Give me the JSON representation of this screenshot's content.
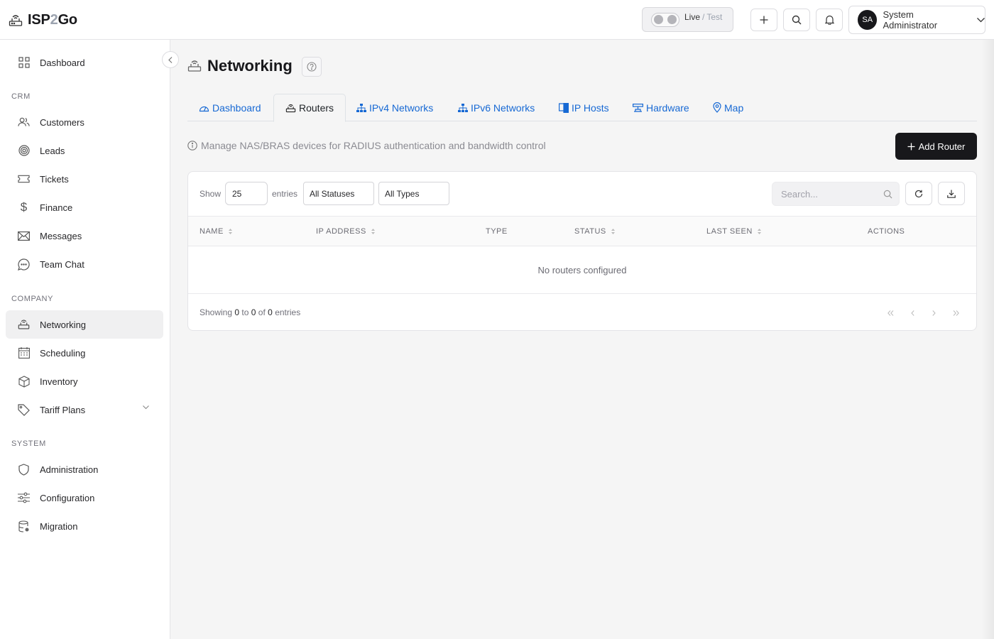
{
  "header": {
    "logo_prefix": "ISP",
    "logo_mid": "2",
    "logo_suffix": "Go",
    "mode_live": "Live",
    "mode_sep": "/",
    "mode_test": "Test",
    "user_initials": "SA",
    "user_name": "System Administrator",
    "icons": [
      "router-icon",
      "plus-icon",
      "search-icon",
      "bell-icon",
      "chevron-down-icon"
    ]
  },
  "sidebar": {
    "top": {
      "label": "Dashboard",
      "icon": "grid-icon"
    },
    "crm_label": "CRM",
    "crm": [
      {
        "label": "Customers",
        "icon": "users-icon"
      },
      {
        "label": "Leads",
        "icon": "target-icon"
      },
      {
        "label": "Tickets",
        "icon": "ticket-icon"
      },
      {
        "label": "Finance",
        "icon": "dollar-icon"
      },
      {
        "label": "Messages",
        "icon": "mail-icon"
      },
      {
        "label": "Team Chat",
        "icon": "chat-icon"
      }
    ],
    "company_label": "COMPANY",
    "company": [
      {
        "label": "Networking",
        "icon": "router-icon",
        "active": true
      },
      {
        "label": "Scheduling",
        "icon": "calendar-icon"
      },
      {
        "label": "Inventory",
        "icon": "box-icon"
      },
      {
        "label": "Tariff Plans",
        "icon": "tag-icon"
      }
    ],
    "system_label": "SYSTEM",
    "system": [
      {
        "label": "Administration",
        "icon": "shield-icon"
      },
      {
        "label": "Configuration",
        "icon": "sliders-icon"
      },
      {
        "label": "Migration",
        "icon": "database-icon"
      }
    ]
  },
  "page": {
    "title": "Networking",
    "tabs": [
      {
        "label": "Dashboard",
        "icon": "gauge-icon"
      },
      {
        "label": "Routers",
        "icon": "router-icon",
        "active": true
      },
      {
        "label": "IPv4 Networks",
        "icon": "sitemap-icon"
      },
      {
        "label": "IPv6 Networks",
        "icon": "sitemap-icon"
      },
      {
        "label": "IP Hosts",
        "icon": "device-icon"
      },
      {
        "label": "Hardware",
        "icon": "hardware-icon"
      },
      {
        "label": "Map",
        "icon": "map-pin-icon"
      }
    ],
    "description": "Manage NAS/BRAS devices for RADIUS authentication and bandwidth control",
    "add_button": "Add Router"
  },
  "table": {
    "show_label": "Show",
    "entries_value": "25",
    "entries_label": "entries",
    "status_filter": "All Statuses",
    "type_filter": "All Types",
    "search_placeholder": "Search...",
    "columns": [
      "NAME",
      "IP ADDRESS",
      "TYPE",
      "STATUS",
      "LAST SEEN",
      "ACTIONS"
    ],
    "empty_message": "No routers configured",
    "footer": {
      "showing": "Showing",
      "from": "0",
      "to_word": "to",
      "to": "0",
      "of_word": "of",
      "total": "0",
      "entries": "entries"
    }
  }
}
